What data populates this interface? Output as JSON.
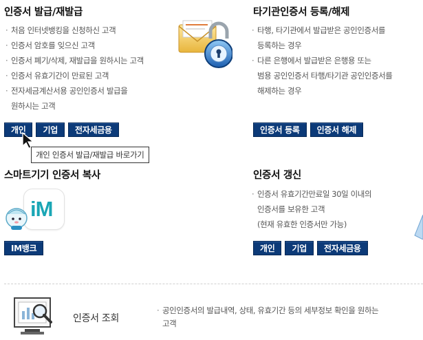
{
  "issue": {
    "title": "인증서 발급/재발급",
    "bullets": [
      "처음 인터넷뱅킹을 신청하신 고객",
      "인증서 암호를 잊으신 고객",
      "인증서 폐기/삭제, 재발급을 원하시는 고객",
      "인증서 유효기간이 만료된 고객",
      "전자세금계산서용 공인인증서 발급을",
      "원하시는 고객"
    ],
    "buttons": [
      "개인",
      "기업",
      "전자세금용"
    ],
    "tooltip": "개인 인증서 발급/재발급 바로가기",
    "icon": "envelope-lock-icon"
  },
  "register": {
    "title": "타기관인증서 등록/해제",
    "bullets": [
      "타행, 타기관에서 발급받은 공인인증서를",
      "등록하는 경우",
      "다른 은행에서 발급받은 은행용 또는",
      "범용 공인인증서 타행/타기관 공인인증서를",
      "해제하는 경우"
    ],
    "buttons": [
      "인증서 등록",
      "인증서 해제"
    ]
  },
  "smart": {
    "title": "스마트기기 인증서 복사",
    "logo_text": "iM",
    "buttons": [
      "IM뱅크"
    ]
  },
  "renew": {
    "title": "인증서 갱신",
    "bullets": [
      "인증서 유효기간만료일 30일 이내의",
      "인증서를 보유한 고객",
      "(현재 유효한 인증서만 가능)"
    ],
    "buttons": [
      "개인",
      "기업",
      "전자세금용"
    ]
  },
  "lookup": {
    "title": "인증서 조회",
    "desc_line1": "공인인증서의 발급내역, 상태, 유효기간 등의 세부정보 확인을 원하는",
    "desc_line2": "고객"
  },
  "colors": {
    "button_bg": "#0c3a78",
    "accent_teal": "#1aa6b5"
  }
}
